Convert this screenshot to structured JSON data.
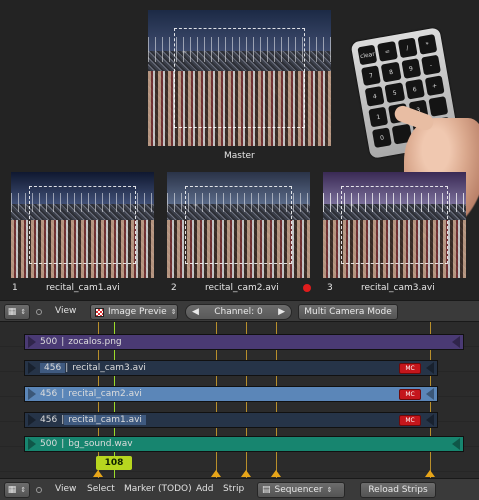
{
  "preview": {
    "master_label": "Master",
    "cameras": [
      {
        "number": "1",
        "name": "recital_cam1.avi"
      },
      {
        "number": "2",
        "name": "recital_cam2.avi",
        "recording": true
      },
      {
        "number": "3",
        "name": "recital_cam3.avi"
      }
    ],
    "keypad_keys": [
      "clear",
      "=",
      "/",
      "*",
      "7",
      "8",
      "9",
      "-",
      "4",
      "5",
      "6",
      "+",
      "1",
      "2",
      "3",
      "",
      "0",
      "",
      ".",
      ""
    ]
  },
  "header": {
    "view_menu": "View",
    "display_mode": "Image Previe",
    "channel_label": "Channel: 0",
    "multi_camera_button": "Multi Camera Mode"
  },
  "sequencer": {
    "strips": [
      {
        "length": "500",
        "name": "zocalos.png",
        "kind": "image",
        "color": "#4a3a74"
      },
      {
        "length": "456",
        "name": "recital_cam3.avi",
        "kind": "movie",
        "color": "#263448",
        "mc": "MC"
      },
      {
        "length": "456",
        "name": "recital_cam2.avi",
        "kind": "movie",
        "color": "#5b86b8",
        "mc": "MC"
      },
      {
        "length": "456",
        "name": "recital_cam1.avi",
        "kind": "movie",
        "color": "#263448",
        "mc": "MC"
      },
      {
        "length": "500",
        "name": "bg_sound.wav",
        "kind": "sound",
        "color": "#17856f"
      }
    ],
    "current_frame": "108"
  },
  "footer": {
    "menus": [
      "View",
      "Select",
      "Marker (TODO)",
      "Add",
      "Strip"
    ],
    "editor_type": "Sequencer",
    "reload_button": "Reload Strips"
  }
}
